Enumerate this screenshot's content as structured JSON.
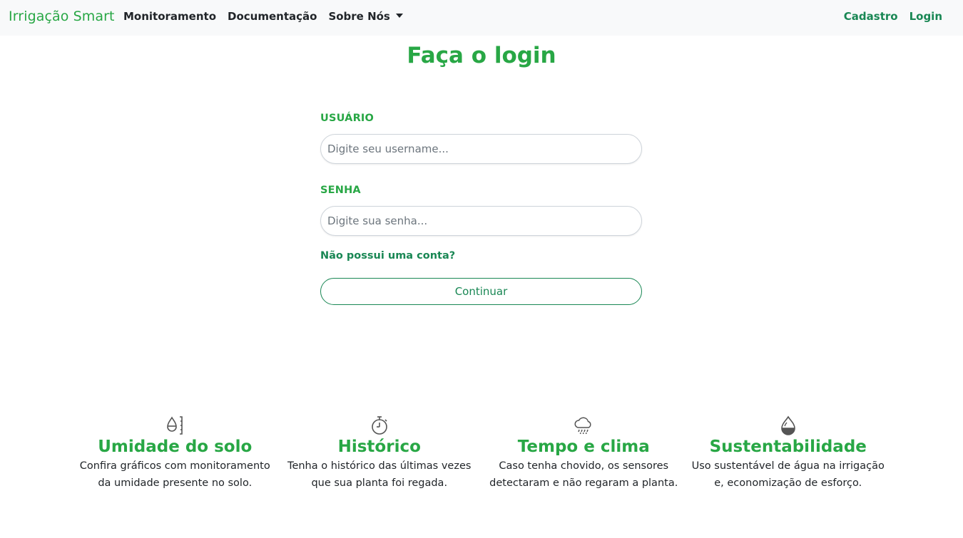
{
  "navbar": {
    "brand": "Irrigação Smart",
    "links": [
      "Monitoramento",
      "Documentação",
      "Sobre Nós"
    ],
    "right_links": [
      "Cadastro",
      "Login"
    ]
  },
  "login": {
    "title": "Faça o login",
    "user_label": "USUÁRIO",
    "user_placeholder": "Digite seu username...",
    "password_label": "SENHA",
    "password_placeholder": "Digite sua senha...",
    "signup_link": "Não possui uma conta?",
    "submit": "Continuar"
  },
  "features": [
    {
      "icon": "soil-moisture-icon",
      "title": "Umidade do solo",
      "text": "Confira gráficos com monitoramento da umidade presente no solo."
    },
    {
      "icon": "stopwatch-icon",
      "title": "Histórico",
      "text": "Tenha o histórico das últimas vezes que sua planta foi regada."
    },
    {
      "icon": "cloud-rain-icon",
      "title": "Tempo e clima",
      "text": "Caso tenha chovido, os sensores detectaram e não regaram a planta."
    },
    {
      "icon": "water-drop-icon",
      "title": "Sustentabilidade",
      "text": "Uso sustentável de água na irrigação e, economização de esforço."
    }
  ],
  "colors": {
    "accent": "#28a745",
    "link_green": "#198754",
    "navbar_bg": "#f8f9fa"
  }
}
